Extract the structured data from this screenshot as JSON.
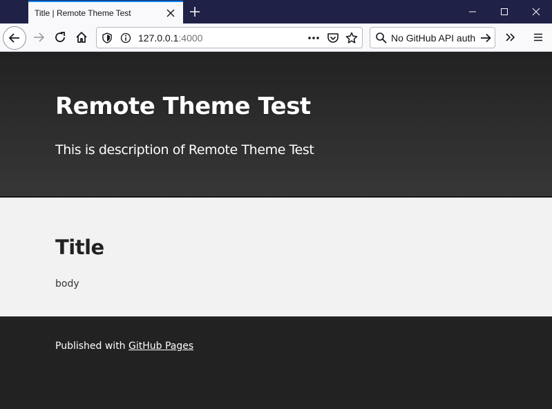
{
  "browser": {
    "tab_title": "Title | Remote Theme Test",
    "url_host": "127.0.0.1",
    "url_port": ":4000",
    "search_text": "No GitHub API authe",
    "icons": {
      "close_tab": "close-icon",
      "new_tab": "plus-icon",
      "minimize": "minimize-icon",
      "maximize": "maximize-icon",
      "close_window": "close-window-icon",
      "back": "back-arrow-icon",
      "forward": "forward-arrow-icon",
      "reload": "reload-icon",
      "home": "home-icon",
      "tracking": "shield-icon",
      "site_info": "info-icon",
      "page_actions": "more-dots-icon",
      "pocket": "pocket-icon",
      "bookmark": "star-icon",
      "search": "magnifier-icon",
      "search_go": "arrow-right-icon",
      "overflow": "double-chevron-icon",
      "menu": "hamburger-menu-icon"
    }
  },
  "site": {
    "title": "Remote Theme Test",
    "description": "This is description of Remote Theme Test"
  },
  "post": {
    "title": "Title",
    "body": "body"
  },
  "footer": {
    "prefix": "Published with ",
    "link_text": "GitHub Pages"
  },
  "colors": {
    "titlebar": "#1f2147",
    "tab_accent": "#0a84ff",
    "header_bg": "#222222",
    "main_bg": "#f2f2f2",
    "footer_bg": "#222222"
  }
}
